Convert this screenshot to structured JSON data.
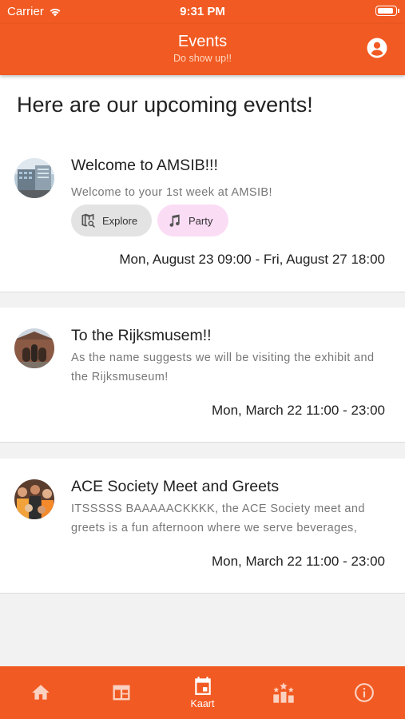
{
  "status_bar": {
    "carrier": "Carrier",
    "time": "9:31 PM"
  },
  "app_bar": {
    "title": "Events",
    "subtitle": "Do show up!!"
  },
  "page_heading": "Here are our upcoming events!",
  "events": [
    {
      "title": "Welcome to AMSIB!!!",
      "description": "Welcome to your 1st week at AMSIB!",
      "tags": [
        {
          "label": "Explore",
          "icon": "map-search-icon"
        },
        {
          "label": "Party",
          "icon": "music-note-icon"
        }
      ],
      "date": "Mon, August 23 09:00 - Fri, August 27 18:00"
    },
    {
      "title": "To the Rijksmusem!!",
      "description": "As the name suggests we will be visiting the exhibit and the Rijksmuseum!",
      "date": "Mon, March 22 11:00 - 23:00"
    },
    {
      "title": "ACE Society Meet and Greets",
      "description": "ITSSSSS BAAAAACKKKK, the ACE Society meet and greets is a fun afternoon where we serve beverages, snacks and more",
      "date": "Mon, March 22 11:00 - 23:00"
    }
  ],
  "bottom_nav": [
    {
      "icon": "home-icon",
      "label": ""
    },
    {
      "icon": "calendar-table-icon",
      "label": ""
    },
    {
      "icon": "event-calendar-icon",
      "label": "Kaart",
      "active": true
    },
    {
      "icon": "leaderboard-icon",
      "label": ""
    },
    {
      "icon": "info-icon",
      "label": ""
    }
  ],
  "colors": {
    "primary": "#f15a22",
    "chip_explore": "#e3e3e3",
    "chip_party": "#fbdcf5",
    "background": "#f2f2f2"
  }
}
